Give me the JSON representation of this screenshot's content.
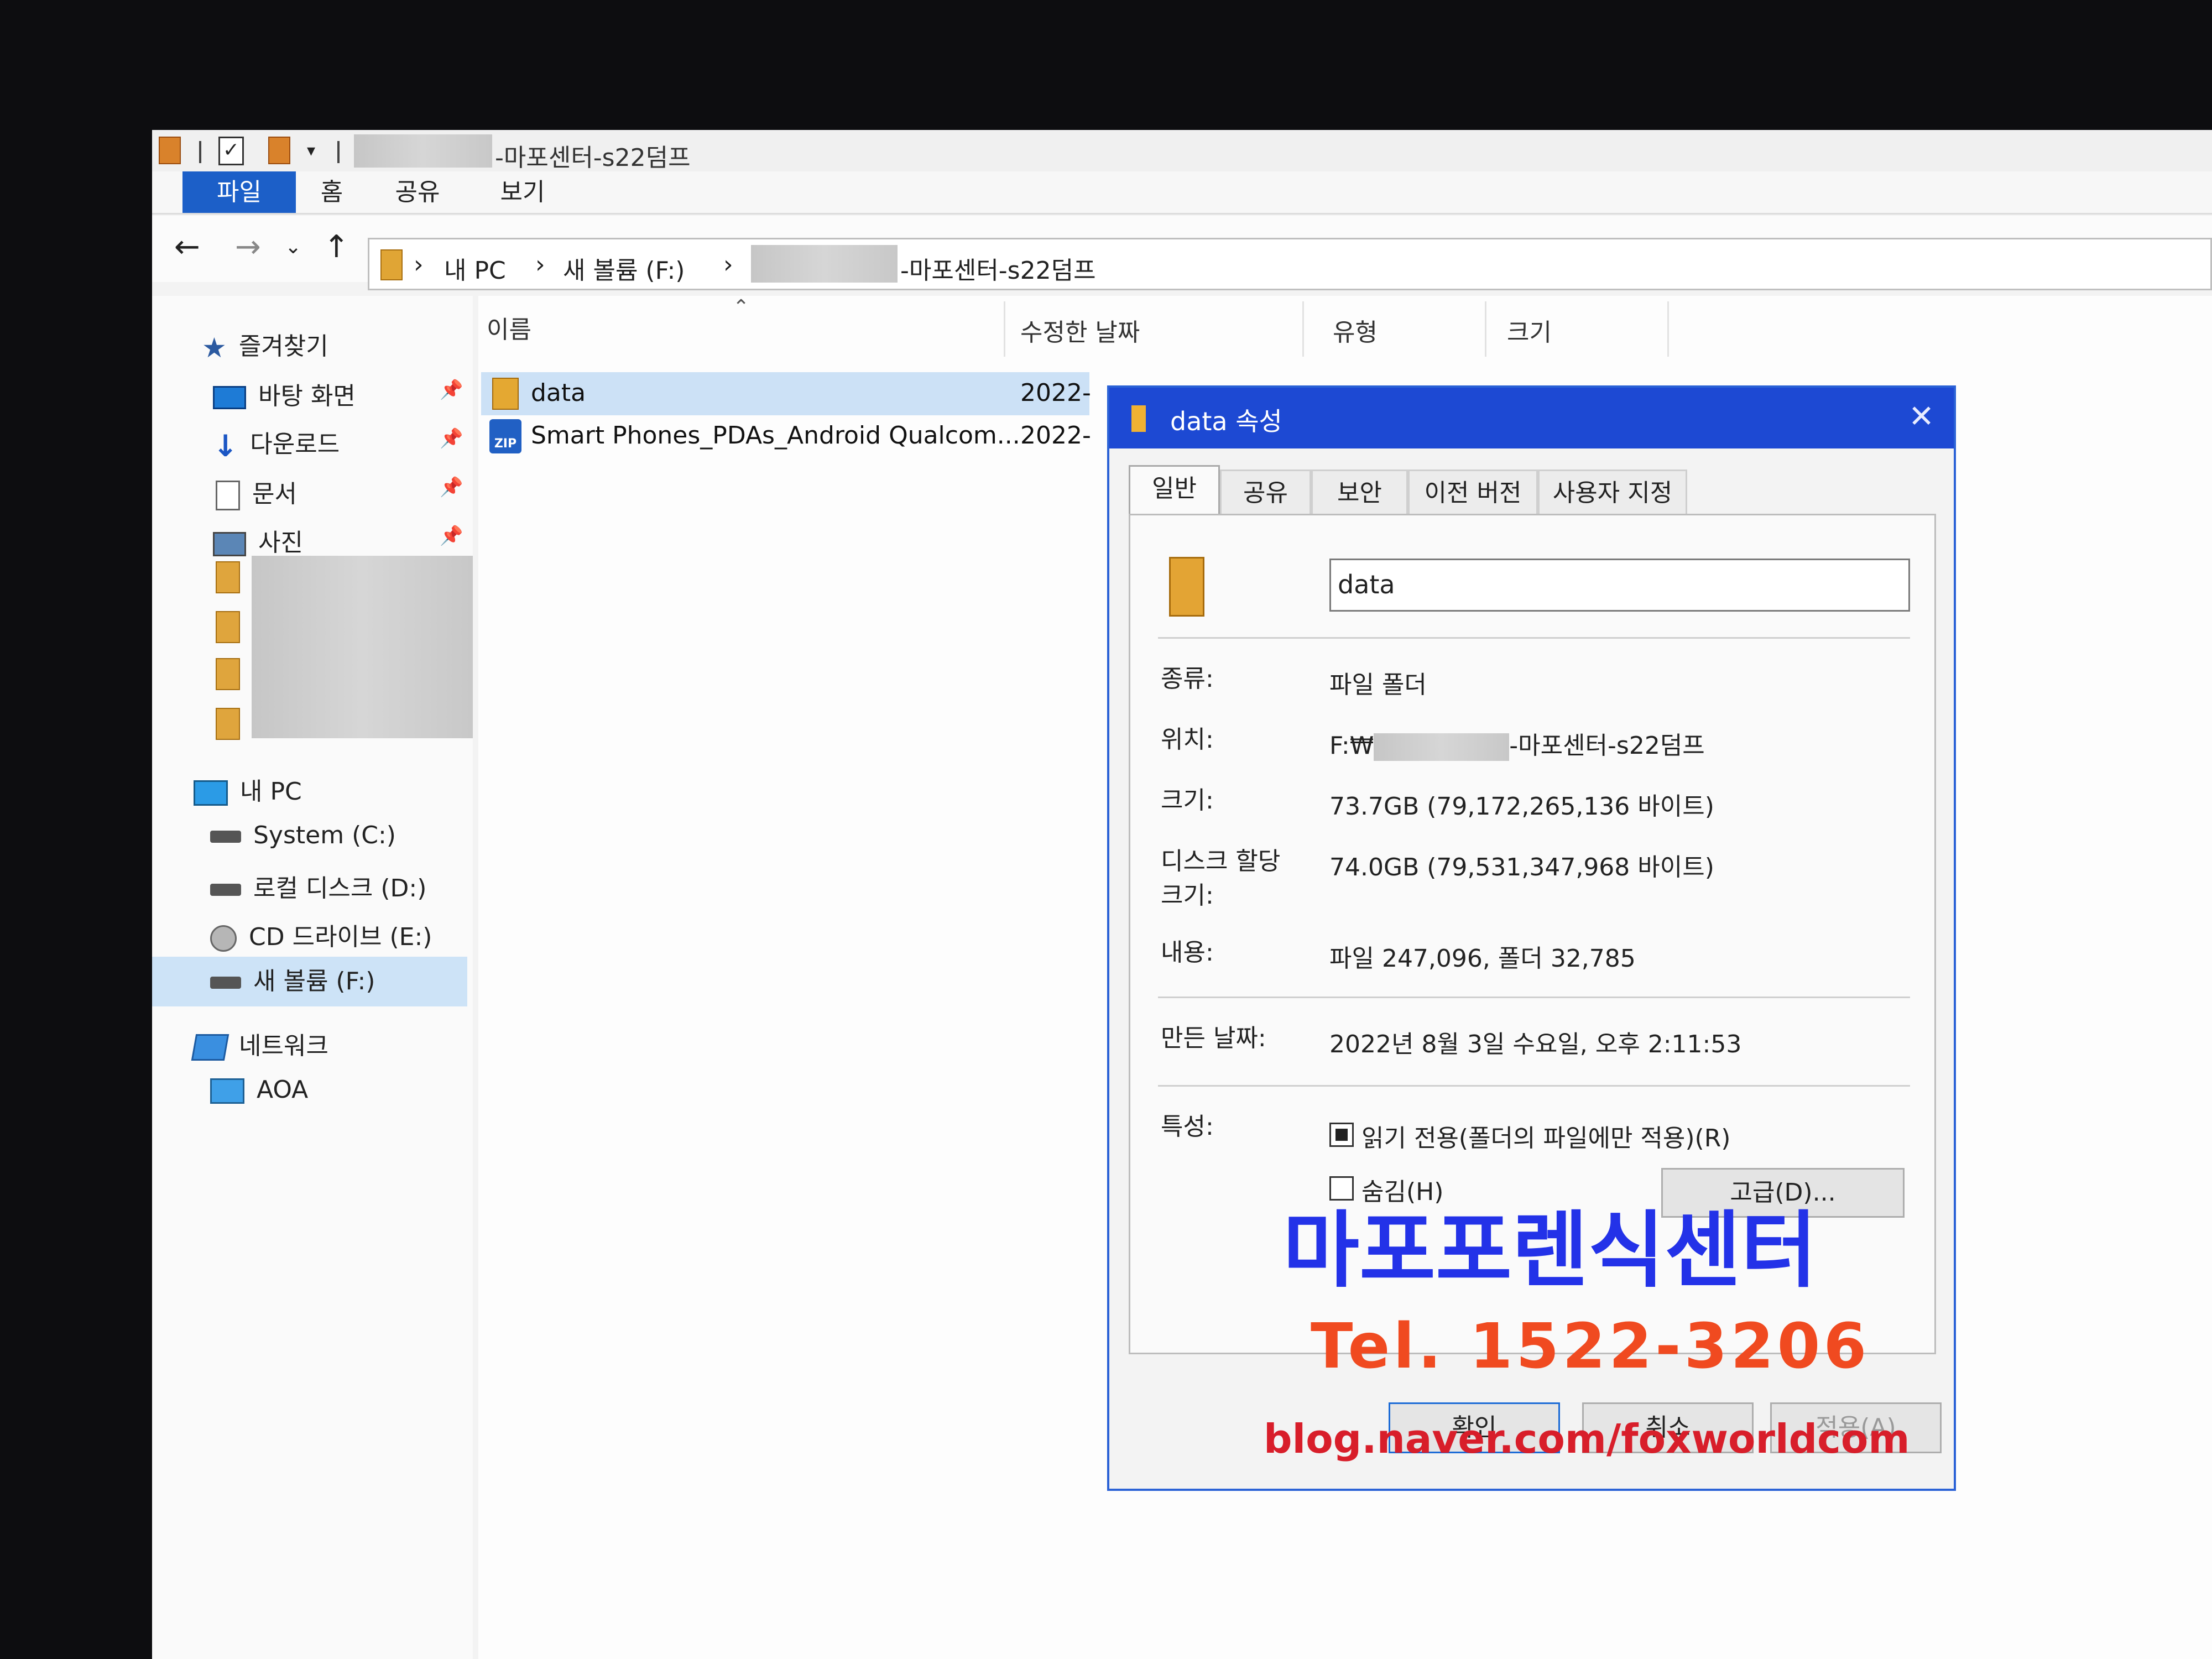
{
  "window": {
    "title_suffix": "-마포센터-s22덤프"
  },
  "ribbon": {
    "tabs": [
      "파일",
      "홈",
      "공유",
      "보기"
    ]
  },
  "address": {
    "crumbs": [
      "내 PC",
      "새 볼륨 (F:)",
      "-마포센터-s22덤프"
    ],
    "separator": "›"
  },
  "sidebar": {
    "quick_access": "즐겨찾기",
    "pinned": [
      "바탕 화면",
      "다운로드",
      "문서",
      "사진"
    ],
    "this_pc": "내 PC",
    "drives": [
      "System (C:)",
      "로컬 디스크 (D:)",
      "CD 드라이브 (E:)",
      "새 볼륨 (F:)"
    ],
    "network": "네트워크",
    "network_items": [
      "AOA"
    ]
  },
  "filelist": {
    "columns": [
      "이름",
      "수정한 날짜",
      "유형",
      "크기"
    ],
    "rows": [
      {
        "name": "data",
        "date": "2022-"
      },
      {
        "name": "Smart Phones_PDAs_Android Qualcom...",
        "date": "2022-"
      }
    ],
    "zip_badge": "ZIP"
  },
  "dialog": {
    "title": "data 속성",
    "close": "✕",
    "tabs": [
      "일반",
      "공유",
      "보안",
      "이전 버전",
      "사용자 지정"
    ],
    "name_value": "data",
    "labels": {
      "type": "종류:",
      "location": "위치:",
      "size": "크기:",
      "size_on_disk": "디스크 할당 크기:",
      "contains": "내용:",
      "created": "만든 날짜:",
      "attributes": "특성:"
    },
    "values": {
      "type": "파일 폴더",
      "location_prefix": "F:₩",
      "location_suffix": "-마포센터-s22덤프",
      "size": "73.7GB (79,172,265,136 바이트)",
      "size_on_disk": "74.0GB (79,531,347,968 바이트)",
      "contains": "파일 247,096, 폴더 32,785",
      "created": "2022년 8월 3일 수요일, 오후 2:11:53"
    },
    "readonly_label": "읽기 전용(폴더의 파일에만 적용)(R)",
    "hidden_label": "숨김(H)",
    "advanced_button": "고급(D)...",
    "ok_button": "확인",
    "cancel_button": "취소",
    "apply_button": "적용(A)"
  },
  "watermark": {
    "name": "마포포렌식센터",
    "phone": "Tel. 1522-3206",
    "blog": "blog.naver.com/foxworldcom"
  },
  "colors": {
    "accent": "#1c5fc8",
    "dialog_title": "#1d49d3",
    "selection": "#cce1f6",
    "watermark_blue": "#2332e8",
    "watermark_orange": "#f04a20",
    "watermark_red": "#d81e2a"
  }
}
